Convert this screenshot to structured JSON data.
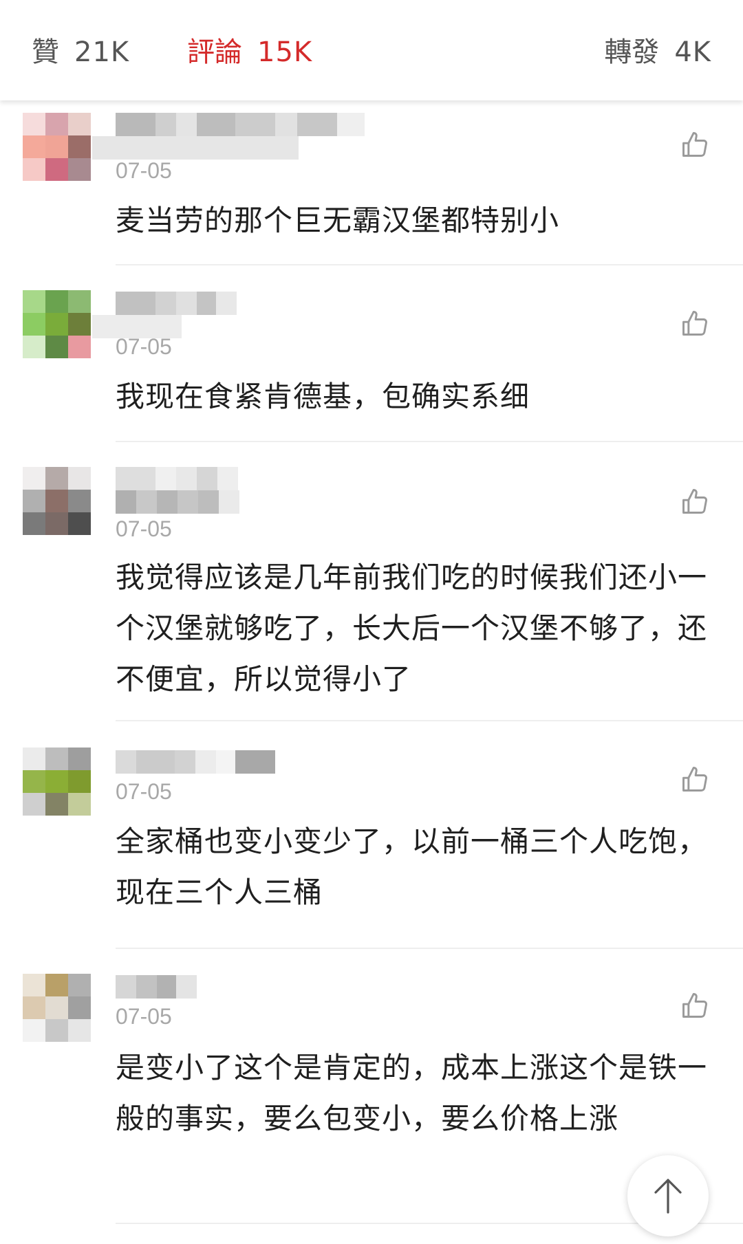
{
  "stats": {
    "likes_label": "贊",
    "likes_count": "21K",
    "comments_label": "評論",
    "comments_count": "15K",
    "reposts_label": "轉發",
    "reposts_count": "4K",
    "active_color": "#d42a2a"
  },
  "comments": [
    {
      "date": "07-05",
      "text": "麦当劳的那个巨无霸汉堡都特别小"
    },
    {
      "date": "07-05",
      "text": "我现在食紧肯德基，包确实系细"
    },
    {
      "date": "07-05",
      "text": "我觉得应该是几年前我们吃的时候我们还小一个汉堡就够吃了，长大后一个汉堡不够了，还不便宜，所以觉得小了"
    },
    {
      "date": "07-05",
      "text": "全家桶也变小变少了，以前一桶三个人吃饱，现在三个人三桶"
    },
    {
      "date": "07-05",
      "text": "是变小了这个是肯定的，成本上涨这个是铁一般的事实，要么包变小，要么价格上涨"
    }
  ],
  "icons": {
    "like": "thumbs-up-icon",
    "scroll_top": "arrow-up-icon"
  }
}
